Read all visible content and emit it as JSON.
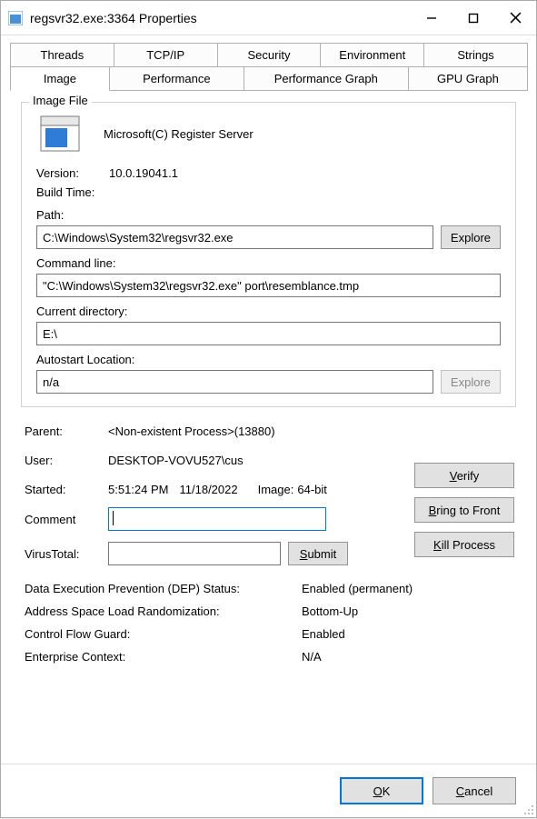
{
  "window": {
    "title": "regsvr32.exe:3364 Properties"
  },
  "tabs": {
    "row1": [
      "Threads",
      "TCP/IP",
      "Security",
      "Environment",
      "Strings"
    ],
    "row2": [
      "Image",
      "Performance",
      "Performance Graph",
      "GPU Graph"
    ],
    "active": "Image"
  },
  "image_file": {
    "group_title": "Image File",
    "description": "Microsoft(C) Register Server",
    "version_label": "Version:",
    "version": "10.0.19041.1",
    "build_time_label": "Build Time:",
    "build_time": "",
    "path_label": "Path:",
    "path": "C:\\Windows\\System32\\regsvr32.exe",
    "explore_btn": "Explore",
    "cmdline_label": "Command line:",
    "cmdline": "\"C:\\Windows\\System32\\regsvr32.exe\" port\\resemblance.tmp",
    "curdir_label": "Current directory:",
    "curdir": "E:\\",
    "autostart_label": "Autostart Location:",
    "autostart": "n/a",
    "explore_btn2": "Explore"
  },
  "info": {
    "parent_label": "Parent:",
    "parent": "<Non-existent Process>(13880)",
    "user_label": "User:",
    "user": "DESKTOP-VOVU527\\cus",
    "started_label": "Started:",
    "started_time": "5:51:24 PM",
    "started_date": "11/18/2022",
    "image_label": "Image:",
    "image_arch": "64-bit",
    "comment_label": "Comment",
    "comment_value": "",
    "vt_label": "VirusTotal:",
    "vt_value": "",
    "submit_btn": "Submit"
  },
  "buttons": {
    "verify": "Verify",
    "bring_to_front": "Bring to Front",
    "kill_process": "Kill Process"
  },
  "security": {
    "dep_label": "Data Execution Prevention (DEP) Status:",
    "dep_value": "Enabled (permanent)",
    "aslr_label": "Address Space Load Randomization:",
    "aslr_value": "Bottom-Up",
    "cfg_label": "Control Flow Guard:",
    "cfg_value": "Enabled",
    "ec_label": "Enterprise Context:",
    "ec_value": "N/A"
  },
  "footer": {
    "ok": "OK",
    "cancel": "Cancel"
  }
}
